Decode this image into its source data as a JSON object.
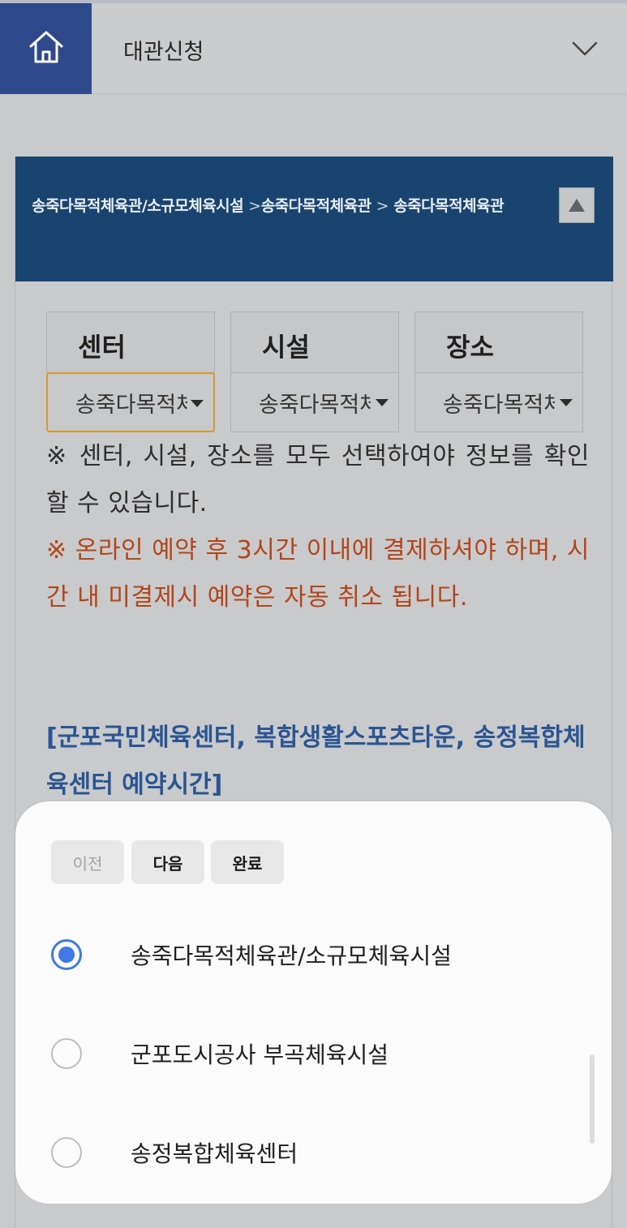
{
  "header": {
    "title": "대관신청",
    "home_icon": "home-icon",
    "chevron_icon": "chevron-down-icon"
  },
  "breadcrumb": {
    "items": [
      "송죽다목적체육관/소규모체육시설",
      "송죽다목적체육관",
      "송죽다목적체육관"
    ],
    "separator": ">"
  },
  "selectors": [
    {
      "label": "센터",
      "value": "송죽다목적체육관"
    },
    {
      "label": "시설",
      "value": "송죽다목적체육관"
    },
    {
      "label": "장소",
      "value": "송죽다목적체육관"
    }
  ],
  "notices": {
    "info": "※ 센터, 시설, 장소를 모두 선택하여야 정보를 확인할 수 있습니다.",
    "warning": "※ 온라인 예약 후 3시간 이내에 결제하셔야 하며, 시간 내 미결제시 예약은 자동 취소 됩니다.",
    "heading": "[군포국민체육센터, 복합생활스포츠타운, 송정복합체육센터 예약시간]"
  },
  "picker": {
    "prev_label": "이전",
    "next_label": "다음",
    "done_label": "완료",
    "options": [
      {
        "label": "송죽다목적체육관/소규모체육시설",
        "selected": true
      },
      {
        "label": "군포도시공사 부곡체육시설",
        "selected": false
      },
      {
        "label": "송정복합체육센터",
        "selected": false
      }
    ]
  },
  "colors": {
    "home_bg": "#2f4a8a",
    "breadcrumb_bg": "#18446f",
    "warning_text": "#b2461a",
    "heading_text": "#2a5592",
    "radio_selected": "#3e79e6",
    "focus_border": "#d39a2e"
  }
}
